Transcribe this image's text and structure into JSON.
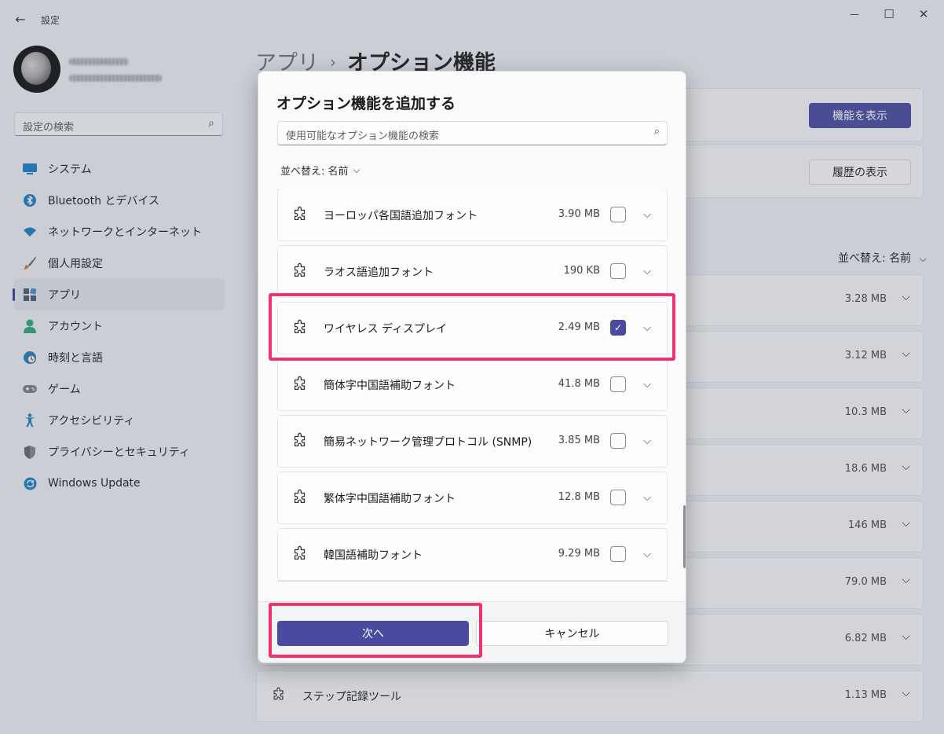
{
  "window": {
    "app_title": "設定",
    "back_icon": "←",
    "minimize_icon": "—",
    "maximize_icon": "☐",
    "close_icon": "✕"
  },
  "sidebar": {
    "search_placeholder": "設定の検索",
    "search_icon": "⌕",
    "items": [
      {
        "label": "システム",
        "icon": "display-icon",
        "color": "#0f78b8"
      },
      {
        "label": "Bluetooth とデバイス",
        "icon": "bluetooth-icon",
        "color": "#0f6cbd"
      },
      {
        "label": "ネットワークとインターネット",
        "icon": "wifi-icon",
        "color": "#0f6cbd"
      },
      {
        "label": "個人用設定",
        "icon": "brush-icon",
        "color": "#c05a2a"
      },
      {
        "label": "アプリ",
        "icon": "apps-icon",
        "color": "#4a5a70"
      },
      {
        "label": "アカウント",
        "icon": "person-icon",
        "color": "#2c9e6a"
      },
      {
        "label": "時刻と言語",
        "icon": "globe-clock-icon",
        "color": "#0f6cbd"
      },
      {
        "label": "ゲーム",
        "icon": "gamepad-icon",
        "color": "#707070"
      },
      {
        "label": "アクセシビリティ",
        "icon": "accessibility-icon",
        "color": "#0f6cbd"
      },
      {
        "label": "プライバシーとセキュリティ",
        "icon": "shield-icon",
        "color": "#7a7a7a"
      },
      {
        "label": "Windows Update",
        "icon": "update-icon",
        "color": "#0f6cbd"
      }
    ],
    "selected_index": 4
  },
  "main": {
    "breadcrumb_parent": "アプリ",
    "breadcrumb_sep": "›",
    "breadcrumb_current": "オプション機能",
    "view_features_label": "機能を表示",
    "view_history_label": "履歴の表示",
    "sort_label": "並べ替え: 名前",
    "sort_chevron": "⌵",
    "installed_sizes": [
      "3.28 MB",
      "3.12 MB",
      "10.3 MB",
      "18.6 MB",
      "146 MB",
      "79.0 MB",
      "6.82 MB",
      "1.13 MB"
    ],
    "last_item_name": "ステップ記録ツール"
  },
  "dialog": {
    "title": "オプション機能を追加する",
    "search_placeholder": "使用可能なオプション機能の検索",
    "search_icon": "⌕",
    "sort_label": "並べ替え: 名前",
    "sort_chevron": "⌵",
    "items": [
      {
        "name": "ヨーロッパ各国語追加フォント",
        "size": "3.90 MB",
        "checked": false
      },
      {
        "name": "ラオス語追加フォント",
        "size": "190 KB",
        "checked": false
      },
      {
        "name": "ワイヤレス ディスプレイ",
        "size": "2.49 MB",
        "checked": true
      },
      {
        "name": "簡体字中国語補助フォント",
        "size": "41.8 MB",
        "checked": false
      },
      {
        "name": "簡易ネットワーク管理プロトコル (SNMP)",
        "size": "3.85 MB",
        "checked": false
      },
      {
        "name": "繁体字中国語補助フォント",
        "size": "12.8 MB",
        "checked": false
      },
      {
        "name": "韓国語補助フォント",
        "size": "9.29 MB",
        "checked": false
      }
    ],
    "next_label": "次へ",
    "cancel_label": "キャンセル",
    "check_glyph": "✓",
    "row_chevron": "⌵"
  },
  "colors": {
    "accent": "#4a4aa0",
    "highlight": "#f1336b"
  }
}
